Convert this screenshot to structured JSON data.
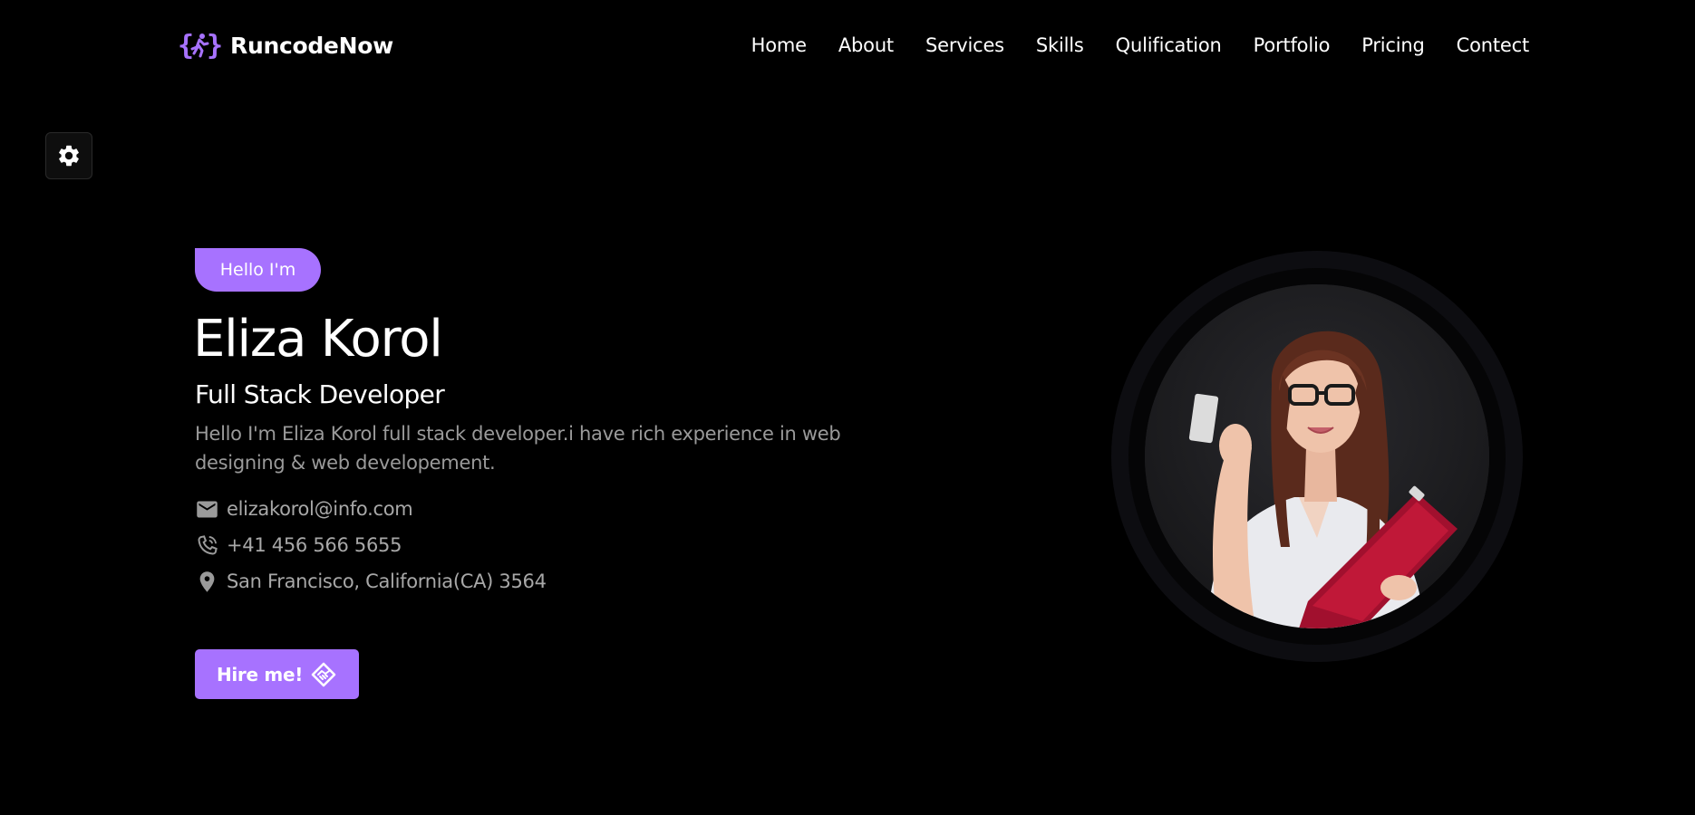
{
  "header": {
    "brand": {
      "name": "RuncodeNow",
      "logo_icon": "curly-brace-runner-icon",
      "accent_color": "#a772ff"
    },
    "nav": [
      {
        "label": "Home"
      },
      {
        "label": "About"
      },
      {
        "label": "Services"
      },
      {
        "label": "Skills"
      },
      {
        "label": "Qulification"
      },
      {
        "label": "Portfolio"
      },
      {
        "label": "Pricing"
      },
      {
        "label": "Contect"
      }
    ]
  },
  "settings": {
    "icon": "gear-icon"
  },
  "hero": {
    "greeting": "Hello I'm",
    "name": "Eliza Korol",
    "role": "Full Stack Developer",
    "description": "Hello I'm Eliza Korol full stack developer.i have rich experience in web designing & web developement.",
    "contacts": [
      {
        "icon": "email-icon",
        "text": "elizakorol@info.com"
      },
      {
        "icon": "phone-icon",
        "text": "+41 456 566 5655"
      },
      {
        "icon": "location-pin-icon",
        "text": "San Francisco, California(CA) 3564"
      }
    ],
    "cta": {
      "label": "Hire me!",
      "icon": "handshake-icon"
    },
    "portrait_alt": "woman with glasses holding a card and a red clipboard"
  },
  "colors": {
    "background": "#000000",
    "accent": "#a772ff",
    "muted_text": "#9a9a9a"
  }
}
